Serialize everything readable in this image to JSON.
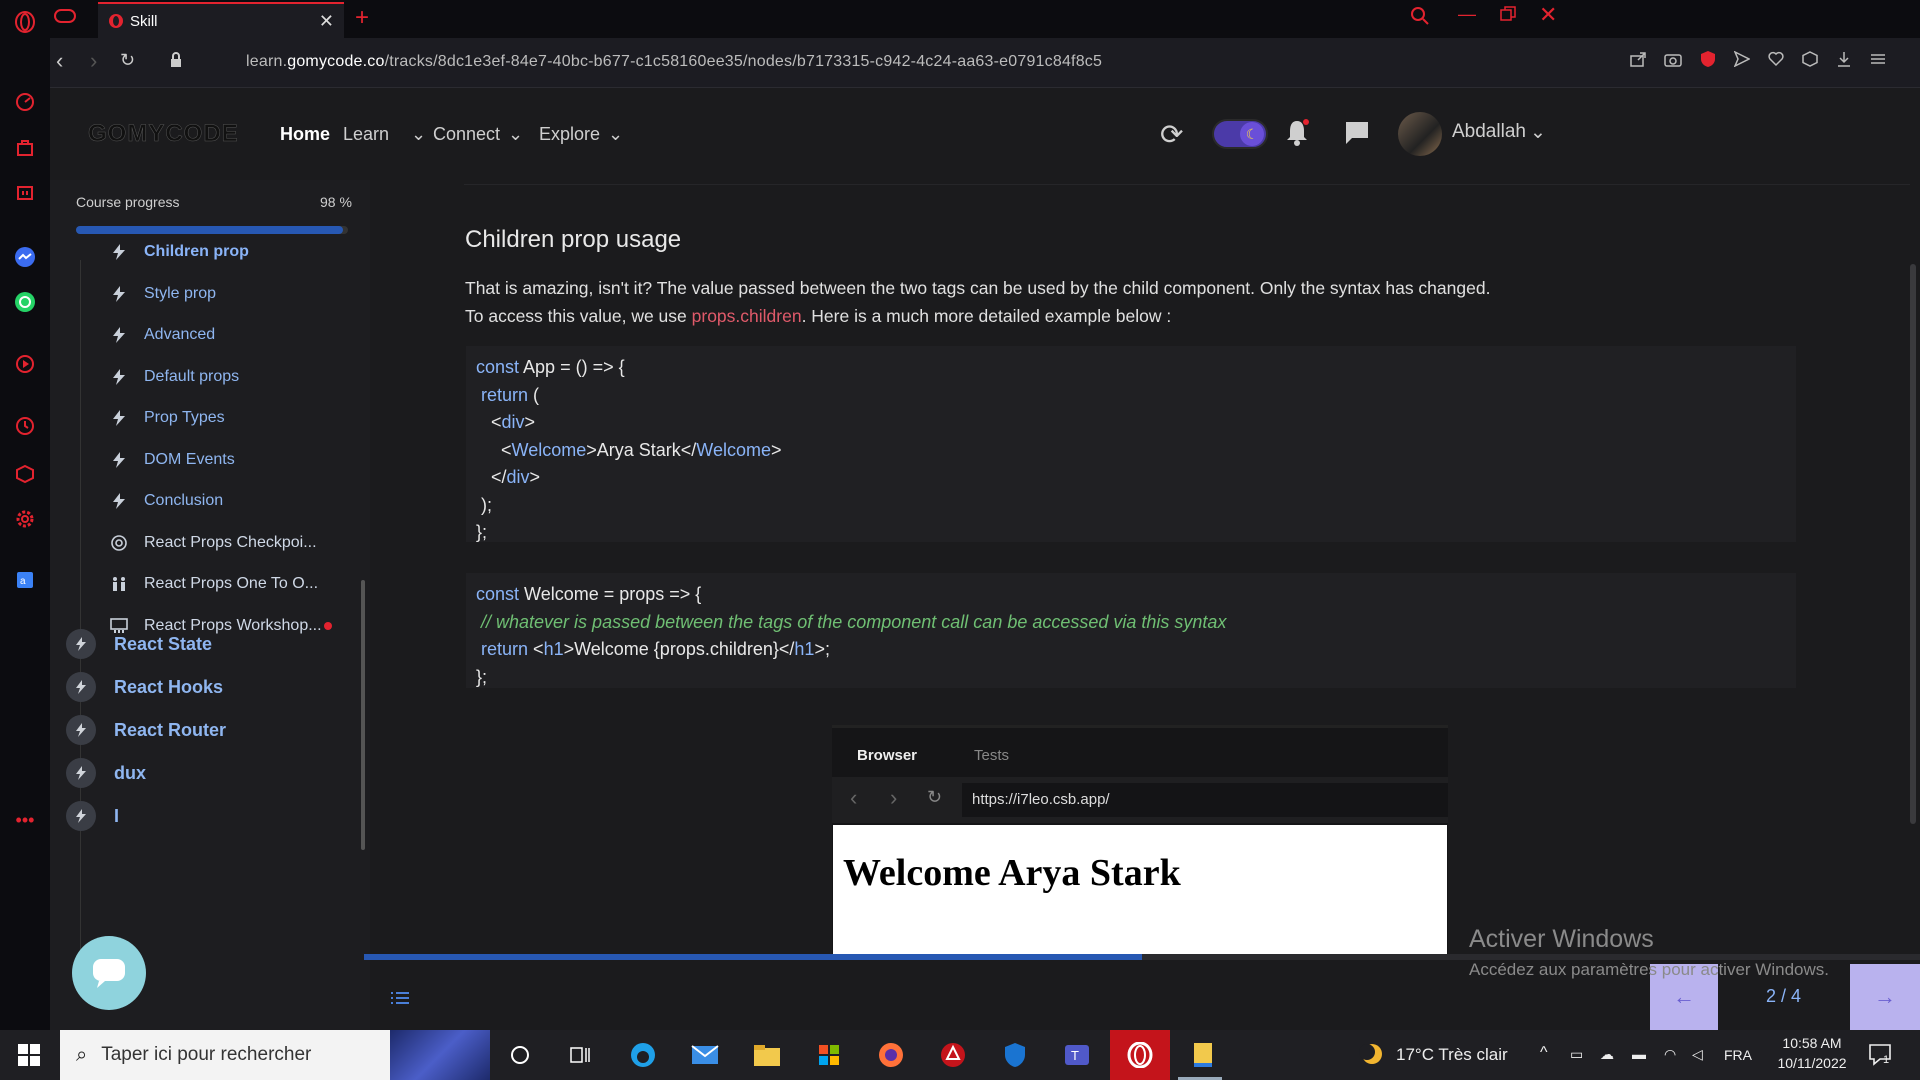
{
  "browser": {
    "tab_title": "Skill",
    "url_prefix": "learn.",
    "url_domain": "gomycode.co",
    "url_path": "/tracks/8dc1e3ef-84e7-40bc-b677-c1c58160ee35/nodes/b7173315-c942-4c24-aa63-e0791c84f8c5"
  },
  "header": {
    "logo": "GOMYCODE",
    "nav": [
      "Home",
      "Learn",
      "Connect",
      "Explore"
    ],
    "user_name": "Abdallah"
  },
  "course": {
    "progress_label": "Course progress",
    "progress_text": "98 %",
    "progress_value": 0.98,
    "lessons": [
      {
        "label": "Children prop",
        "icon": "bolt-icon",
        "active": true
      },
      {
        "label": "Style prop",
        "icon": "bolt-icon"
      },
      {
        "label": "Advanced",
        "icon": "bolt-icon"
      },
      {
        "label": "Default props",
        "icon": "bolt-icon"
      },
      {
        "label": "Prop Types",
        "icon": "bolt-icon"
      },
      {
        "label": "DOM Events",
        "icon": "bolt-icon"
      },
      {
        "label": "Conclusion",
        "icon": "bolt-icon"
      },
      {
        "label": "React Props Checkpoi...",
        "icon": "target-icon"
      },
      {
        "label": "React Props One To O...",
        "icon": "people-icon"
      },
      {
        "label": "React Props Workshop...",
        "icon": "workshop-icon"
      }
    ],
    "modules": [
      "React State",
      "React Hooks",
      "React Router",
      "dux",
      "I"
    ]
  },
  "content": {
    "heading": "Children prop usage",
    "para1": "That is amazing, isn't it? The value passed between the two tags can be used by the child component. Only the syntax has changed.",
    "para2_a": "To access this value, we use ",
    "para2_link": "props.children",
    "para2_b": ". Here is a much more detailed example below :",
    "preview": {
      "tab_browser": "Browser",
      "tab_tests": "Tests",
      "url": "https://i7leo.csb.app/",
      "output": "Welcome Arya Stark"
    }
  },
  "pager": {
    "text": "2 / 4",
    "progress": 0.5
  },
  "watermark": {
    "title": "Activer Windows",
    "subtitle": "Accédez aux paramètres pour activer Windows."
  },
  "taskbar": {
    "search_placeholder": "Taper ici pour rechercher",
    "weather": "17°C  Très clair",
    "lang": "FRA",
    "time": "10:58 AM",
    "date": "10/11/2022",
    "notif_count": "1"
  },
  "colors": {
    "accent": "#8ab4f8",
    "link": "#e05a6a",
    "progress": "#2758b3",
    "toggle": "#6a4fd8"
  }
}
